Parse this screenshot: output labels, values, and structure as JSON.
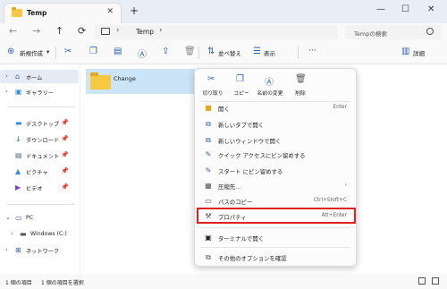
{
  "window": {
    "tab_title": "Temp",
    "tab_close": "✕",
    "tab_add": "+",
    "minimize": "—",
    "maximize": "☐",
    "close": "✕"
  },
  "address": {
    "back": "←",
    "forward": "→",
    "up": "↑",
    "refresh": "⟳",
    "path_segment": "Temp",
    "search_placeholder": "Tempの検索"
  },
  "toolbar": {
    "new_label": "新規作成",
    "new_caret": "▾",
    "sort_label": "並べ替え",
    "view_label": "表示",
    "more": "···",
    "details_label": "詳細"
  },
  "sidebar": {
    "home": "ホーム",
    "gallery": "ギャラリー",
    "desktop": "デスクトップ",
    "downloads": "ダウンロード",
    "documents": "ドキュメント",
    "pictures": "ピクチャ",
    "videos": "ビデオ",
    "pc": "PC",
    "windows_drive": "Windows (C:)",
    "network": "ネットワーク"
  },
  "content": {
    "folder_name": "Change"
  },
  "status": {
    "item_count": "1 個の項目",
    "selected_count": "1 個の項目を選択"
  },
  "context_menu": {
    "quick_actions": [
      {
        "label": "切り取り"
      },
      {
        "label": "コピー"
      },
      {
        "label": "名前の変更"
      },
      {
        "label": "削除"
      }
    ],
    "items": [
      {
        "label": "開く",
        "shortcut": "Enter"
      },
      {
        "label": "新しいタブで開く",
        "shortcut": ""
      },
      {
        "label": "新しいウィンドウで開く",
        "shortcut": ""
      },
      {
        "label": "クイック アクセスにピン留めする",
        "shortcut": ""
      },
      {
        "label": "スタート にピン留めする",
        "shortcut": ""
      },
      {
        "label": "圧縮先...",
        "shortcut": "›"
      },
      {
        "label": "パスのコピー",
        "shortcut": "Ctrl+Shift+C"
      },
      {
        "label": "プロパティ",
        "shortcut": "Alt+Enter"
      },
      {
        "label": "ターミナルで開く",
        "shortcut": ""
      },
      {
        "label": "その他のオプションを確認",
        "shortcut": ""
      }
    ],
    "highlighted_item": "プロパティ",
    "highlight_color": "#e02020"
  },
  "colors": {
    "accent": "#2f64b4",
    "folder": "#f7c840",
    "selection": "#cce4f7"
  }
}
